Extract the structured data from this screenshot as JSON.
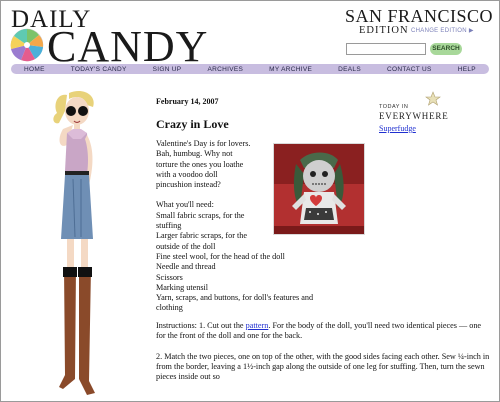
{
  "header": {
    "logo_top": "DAILY",
    "logo_bottom": "CANDY",
    "city": "SAN FRANCISCO",
    "edition": "EDITION",
    "change_edition": "CHANGE EDITION ▶",
    "search_placeholder": "",
    "search_button": "SEARCH"
  },
  "nav": {
    "items": [
      "HOME",
      "TODAY'S CANDY",
      "SIGN UP",
      "ARCHIVES",
      "MY ARCHIVE",
      "DEALS",
      "CONTACT US",
      "HELP"
    ]
  },
  "article": {
    "date": "February 14, 2007",
    "title": "Crazy in Love",
    "intro": [
      "Valentine's Day is for lovers.",
      "Bah, humbug. Why not",
      "torture the ones you loathe",
      "with a voodoo doll",
      "pincushion instead?"
    ],
    "need_heading": "What you'll need:",
    "needs": [
      "Small fabric scraps, for the",
      "stuffing",
      "Larger fabric scraps, for the",
      "outside of the doll",
      "Fine steel wool, for the head of the doll",
      "Needle and thread",
      "Scissors",
      "Marking utensil",
      "Yarn, scraps, and buttons, for doll's features and",
      "clothing"
    ],
    "instructions_heading": "Instructions:",
    "step1_prefix": "1. Cut out the ",
    "step1_link": "pattern",
    "step1_rest_line1": ". For the body of the doll, you'll need",
    "step1_line2": "two identical pieces — one for the front of the doll and",
    "step1_line3": "one for the back.",
    "step2_lines": [
      "2. Match the two pieces, one on top of the other, with the",
      "good sides facing each other. Sew ¼-inch in from the",
      "border, leaving a 1½-inch gap along the outside of one",
      "leg for stuffing. Then, turn the sewn pieces inside out so"
    ]
  },
  "sidebar": {
    "today_small": "TODAY IN",
    "today_big": "EVERYWHERE",
    "link": "Superfudge"
  },
  "colors": {
    "nav_bg": "#c8bde0",
    "search_btn": "#a8d89a",
    "link": "#1f2fd0"
  }
}
